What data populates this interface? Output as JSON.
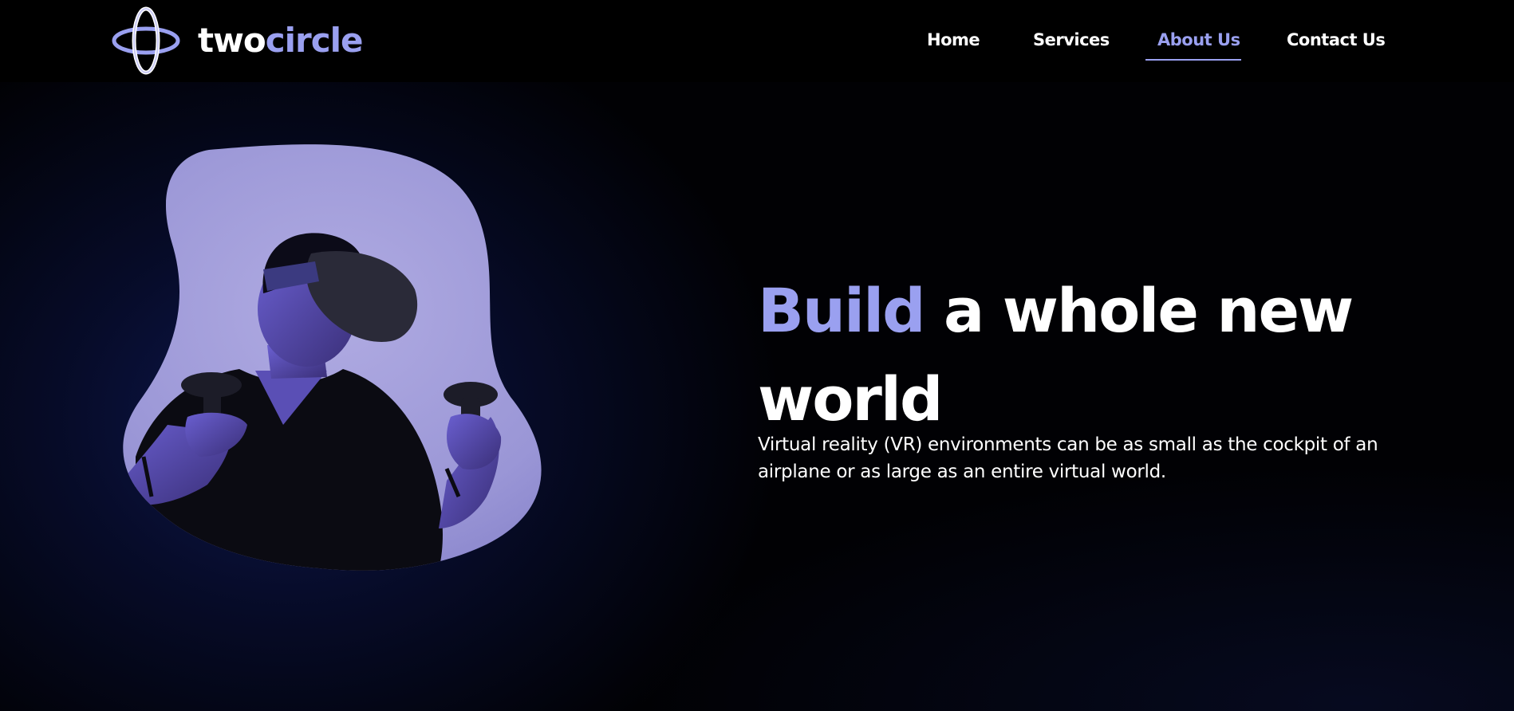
{
  "brand": {
    "name_part1": "two",
    "name_part2": "circle",
    "colors": {
      "accent": "#9aa0f0",
      "text": "#ffffff",
      "background": "#000000"
    }
  },
  "nav": {
    "items": [
      {
        "label": "Home",
        "active": false
      },
      {
        "label": "Services",
        "active": false
      },
      {
        "label": "About Us",
        "active": true
      },
      {
        "label": "Contact Us",
        "active": false
      }
    ]
  },
  "hero": {
    "headline_accent": "Build",
    "headline_rest": " a whole new world",
    "description": "Virtual reality (VR) environments can be as small as the cockpit of an airplane or as large as an entire virtual world.",
    "image_icon": "vr-person-photo"
  }
}
